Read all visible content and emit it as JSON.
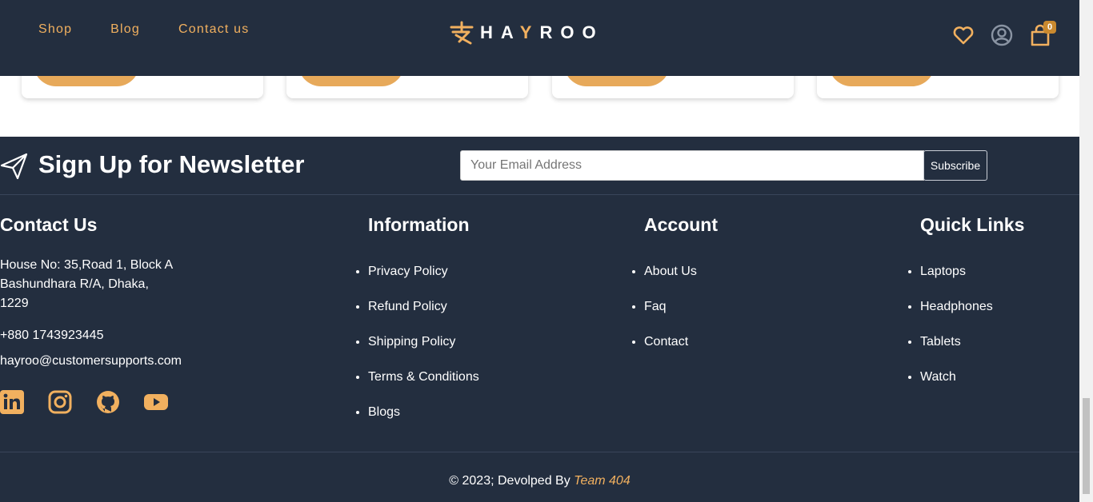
{
  "header": {
    "nav": [
      "Shop",
      "Blog",
      "Contact us"
    ],
    "logo_text": "HAYROO",
    "cart_count": "0"
  },
  "newsletter": {
    "title": "Sign Up for Newsletter",
    "email_placeholder": "Your Email Address",
    "subscribe_label": "Subscribe"
  },
  "footer": {
    "contact": {
      "title": "Contact Us",
      "address_lines": [
        "House No: 35,Road 1, Block A",
        "Bashundhara R/A, Dhaka,",
        "1229"
      ],
      "phone": "+880 1743923445",
      "email": "hayroo@customersupports.com"
    },
    "information": {
      "title": "Information",
      "links": [
        "Privacy Policy",
        "Refund Policy",
        "Shipping Policy",
        "Terms & Conditions",
        "Blogs"
      ]
    },
    "account": {
      "title": "Account",
      "links": [
        "About Us",
        "Faq",
        "Contact"
      ]
    },
    "quick_links": {
      "title": "Quick Links",
      "links": [
        "Laptops",
        "Headphones",
        "Tablets",
        "Watch"
      ]
    },
    "copyright_prefix": "© 2023; Devolped By ",
    "copyright_team": "Team 404"
  },
  "colors": {
    "background": "#232e3f",
    "accent": "#f1b05f",
    "button": "#e7a95a"
  },
  "icons": {
    "header": [
      "heart-icon",
      "user-icon",
      "cart-icon"
    ],
    "social": [
      "linkedin-icon",
      "instagram-icon",
      "github-icon",
      "youtube-icon"
    ],
    "newsletter": "paper-plane-icon"
  }
}
